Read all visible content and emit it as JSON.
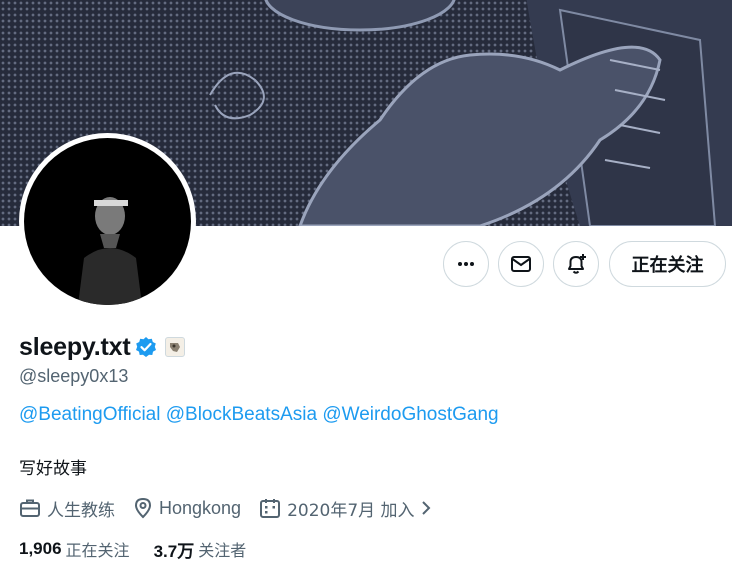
{
  "profile": {
    "display_name": "sleepy.txt",
    "handle": "@sleepy0x13",
    "bio_links": [
      "@BeatingOfficial",
      "@BlockBeatsAsia",
      "@WeirdoGhostGang"
    ],
    "bio": "写好故事",
    "profession": "人生教练",
    "location": "Hongkong",
    "joined": "2020年7月 加入",
    "following_count": "1,906",
    "following_label": "正在关注",
    "followers_count": "3.7万",
    "followers_label": "关注者"
  },
  "actions": {
    "follow_label": "正在关注",
    "more_icon": "ellipsis-icon",
    "message_icon": "mail-icon",
    "notify_icon": "bell-plus-icon"
  },
  "colors": {
    "accent": "#1d9bf0",
    "muted": "#536471",
    "text": "#0f1419",
    "border": "#cfd9de",
    "banner": "#262b3b"
  }
}
